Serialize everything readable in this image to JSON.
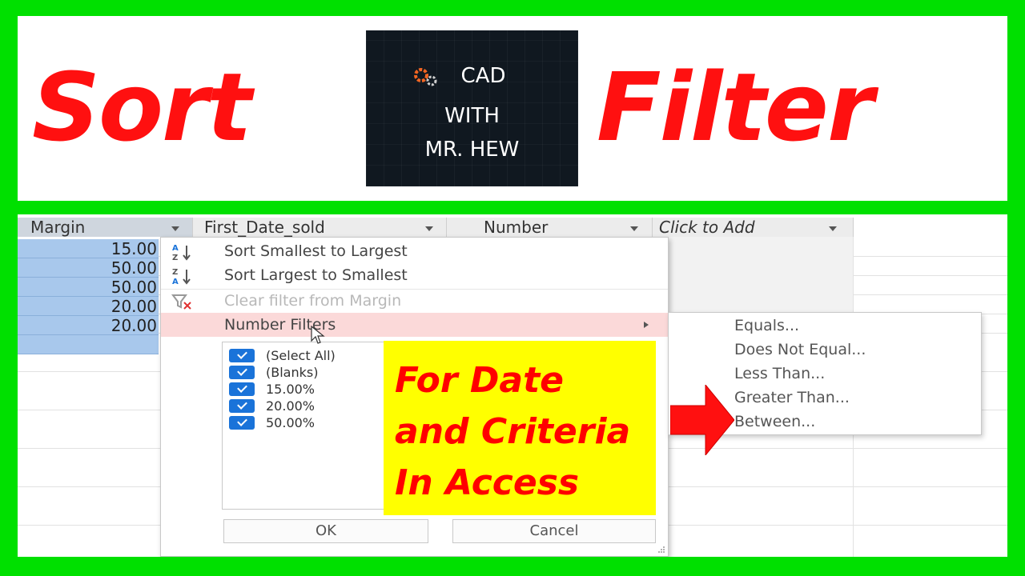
{
  "banner": {
    "left_word": "Sort",
    "right_word": "Filter",
    "logo": {
      "line1": "CAD",
      "line2": "WITH",
      "line3": "MR. HEW",
      "icon": "gear-icon"
    }
  },
  "table": {
    "columns": [
      {
        "label": "Margin"
      },
      {
        "label": "First_Date_sold"
      },
      {
        "label": "Number"
      },
      {
        "label": "Click to Add"
      }
    ],
    "margin_values": [
      "15.00",
      "50.00",
      "50.00",
      "20.00",
      "20.00"
    ]
  },
  "menu": {
    "sort_asc": "Sort Smallest to Largest",
    "sort_desc": "Sort Largest to Smallest",
    "clear_filter": "Clear filter from Margin",
    "number_filters": "Number Filters",
    "checklist": [
      "(Select All)",
      "(Blanks)",
      "15.00%",
      "20.00%",
      "50.00%"
    ],
    "ok": "OK",
    "cancel": "Cancel"
  },
  "submenu": {
    "items": [
      "Equals...",
      "Does Not Equal...",
      "Less Than...",
      "Greater Than...",
      "Between..."
    ]
  },
  "callout": {
    "line1": "For Date",
    "line2": "and Criteria",
    "line3": "In Access"
  },
  "colors": {
    "frame": "#00e000",
    "title_red": "#ff1010",
    "callout_bg": "#ffff00",
    "selection_blue": "#a8c8ec",
    "checkbox_blue": "#1a73d9"
  }
}
